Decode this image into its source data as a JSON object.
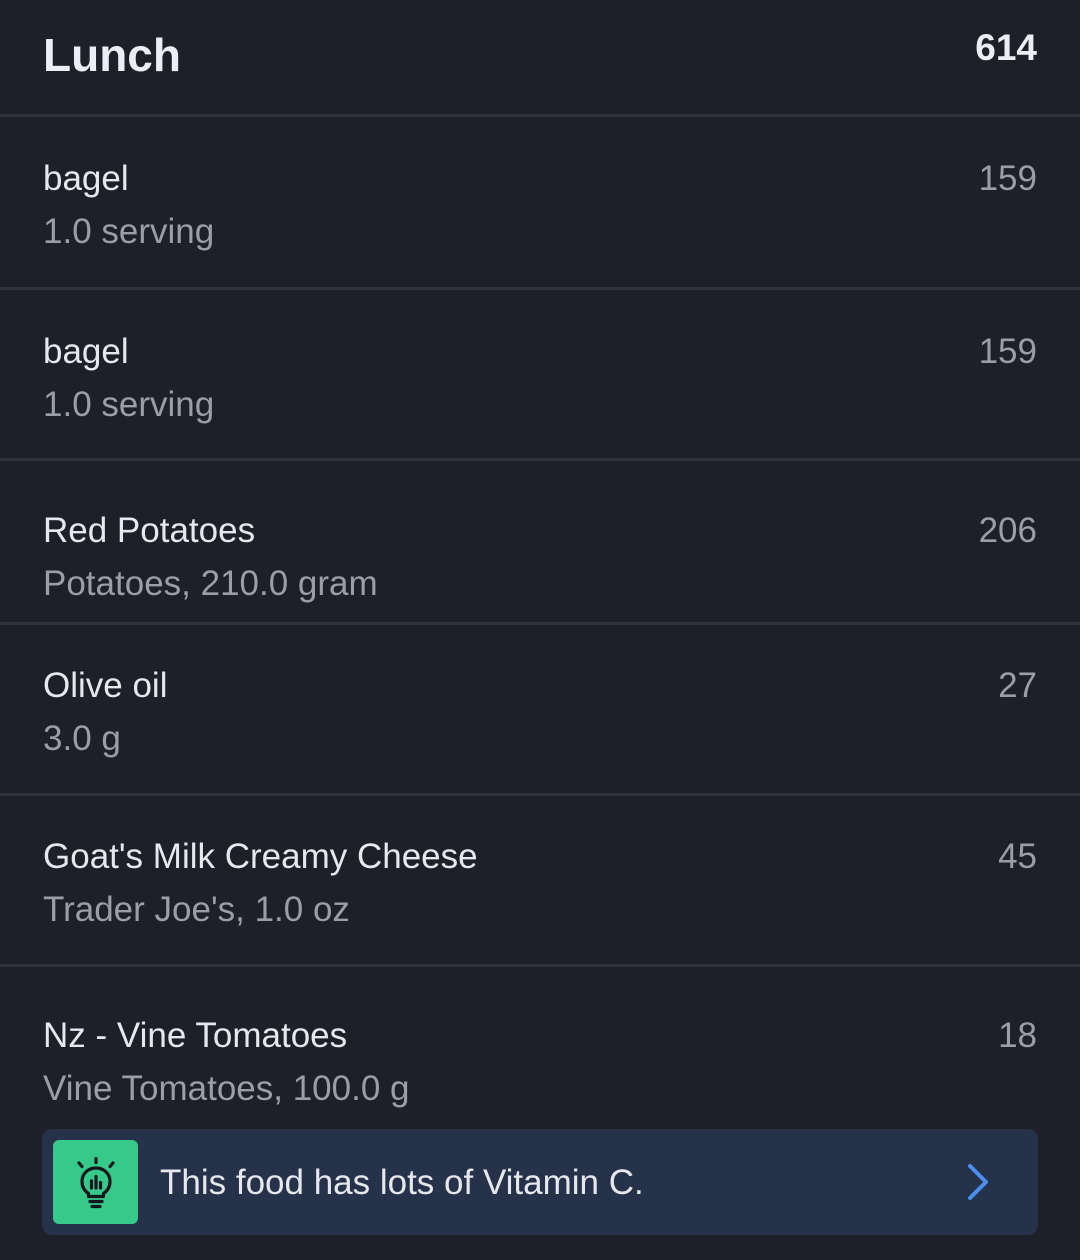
{
  "meal": {
    "title": "Lunch",
    "total_calories": "614"
  },
  "items": [
    {
      "name": "bagel",
      "detail": "1.0 serving",
      "calories": "159"
    },
    {
      "name": "bagel",
      "detail": "1.0 serving",
      "calories": "159"
    },
    {
      "name": "Red Potatoes",
      "detail": "Potatoes, 210.0 gram",
      "calories": "206"
    },
    {
      "name": "Olive oil",
      "detail": "3.0 g",
      "calories": "27"
    },
    {
      "name": "Goat's Milk Creamy Cheese",
      "detail": "Trader Joe's, 1.0 oz",
      "calories": "45"
    },
    {
      "name": "Nz - Vine Tomatoes",
      "detail": "Vine Tomatoes, 100.0 g",
      "calories": "18"
    }
  ],
  "tip": {
    "text": "This food has lots of Vitamin C.",
    "icon": "lightbulb-icon",
    "chevron_icon": "chevron-right-icon",
    "icon_bg_color": "#36c98a",
    "accent_color": "#4a8ff0"
  }
}
